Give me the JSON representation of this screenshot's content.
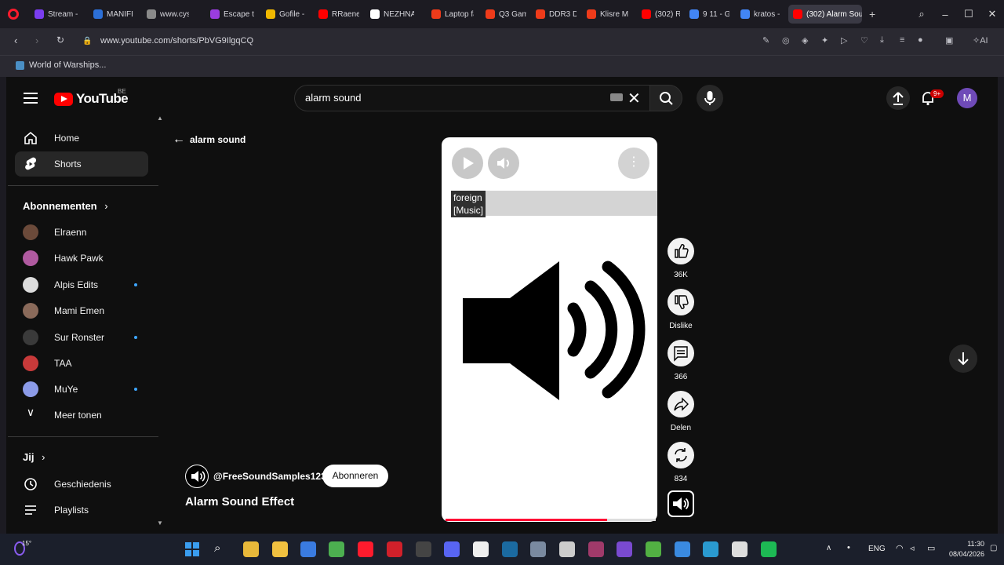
{
  "browser": {
    "tabs": [
      {
        "label": "Stream -",
        "color": "#7a3df0"
      },
      {
        "label": "MANIFES",
        "color": "#2c6fd6"
      },
      {
        "label": "www.cys",
        "color": "#8a8a8a"
      },
      {
        "label": "Escape th",
        "color": "#9a3de0"
      },
      {
        "label": "Gofile - C",
        "color": "#f0b800"
      },
      {
        "label": "RRaenee",
        "color": "#ff0000"
      },
      {
        "label": "NEZHNA",
        "color": "#ffffff"
      },
      {
        "label": "Laptop fa",
        "color": "#ee3b1a"
      },
      {
        "label": "Q3 Gami",
        "color": "#ee3b1a"
      },
      {
        "label": "DDR3 DD",
        "color": "#ee3b1a"
      },
      {
        "label": "Klisre M",
        "color": "#ee3b1a"
      },
      {
        "label": "(302) RR",
        "color": "#ff0000"
      },
      {
        "label": "9 11 - Go",
        "color": "#4285f4"
      },
      {
        "label": "kratos - C",
        "color": "#4285f4"
      },
      {
        "label": "(302) Alarm Sou",
        "color": "#ff0000"
      }
    ],
    "url": "www.youtube.com/shorts/PbVG9IlgqCQ",
    "bookmark": "World of Warships..."
  },
  "header": {
    "logo_text": "YouTube",
    "country_code": "BE",
    "search_value": "alarm sound",
    "notification_count": "9+",
    "avatar_letter": "M"
  },
  "sidebar": {
    "nav": [
      {
        "label": "Home",
        "icon": "home-icon"
      },
      {
        "label": "Shorts",
        "icon": "shorts-icon"
      }
    ],
    "subscriptions_title": "Abonnementen",
    "subscriptions": [
      {
        "label": "Elraenn",
        "color": "#6b4a3a",
        "dot": false
      },
      {
        "label": "Hawk Pawk",
        "color": "#b05aa0",
        "dot": false
      },
      {
        "label": "Alpis Edits",
        "color": "#dcdcdc",
        "dot": true
      },
      {
        "label": "Mami Emen",
        "color": "#8a6a5a",
        "dot": false
      },
      {
        "label": "Sur Ronster",
        "color": "#3a3a3a",
        "dot": true
      },
      {
        "label": "TAA",
        "color": "#c83a3a",
        "dot": false
      },
      {
        "label": "MuYe",
        "color": "#8c9be8",
        "dot": true
      }
    ],
    "show_more": "Meer tonen",
    "you_title": "Jij",
    "you_items": [
      {
        "label": "Geschiedenis",
        "icon": "history-icon"
      },
      {
        "label": "Playlists",
        "icon": "playlists-icon"
      }
    ]
  },
  "short": {
    "back_label": "alarm sound",
    "caption_line1": "foreign",
    "caption_line2": "[Music]",
    "progress": 0.77,
    "channel": "@FreeSoundSamples123",
    "subscribe_label": "Abonneren",
    "title": "Alarm Sound Effect",
    "likes": "36K",
    "dislike_label": "Dislike",
    "comments": "366",
    "share_label": "Delen",
    "remix_count": "834"
  },
  "taskbar": {
    "weather": "15°",
    "lang": "ENG",
    "time": "11:30",
    "date": "08/04/2026"
  }
}
